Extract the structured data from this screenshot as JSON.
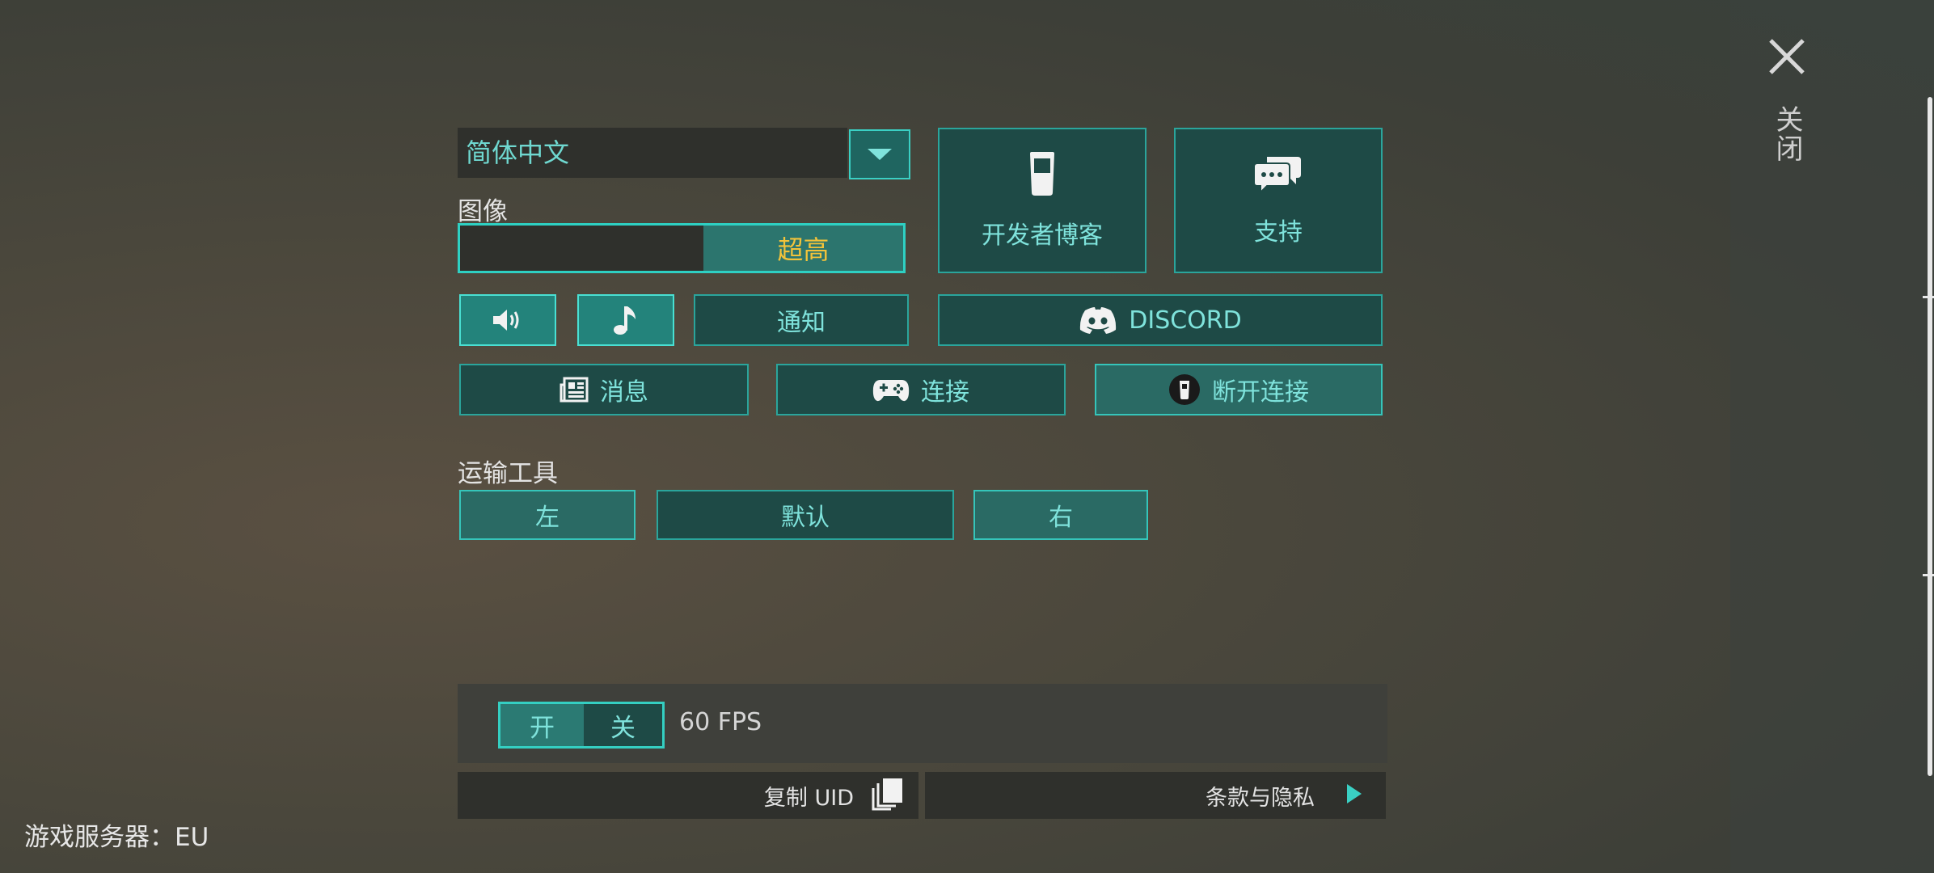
{
  "close": {
    "label": "关闭"
  },
  "language": {
    "selected": "简体中文"
  },
  "graphics": {
    "label": "图像",
    "quality": "超高",
    "level_fraction": 0.45
  },
  "links": {
    "dev_blog": "开发者博客",
    "support": "支持",
    "discord": "DISCORD"
  },
  "audio": {
    "notify": "通知"
  },
  "actions": {
    "news": "消息",
    "connect": "连接",
    "disconnect": "断开连接"
  },
  "vehicle": {
    "label": "运输工具",
    "left": "左",
    "default": "默认",
    "right": "右"
  },
  "fps": {
    "on": "开",
    "off": "关",
    "label": "60 FPS"
  },
  "footer": {
    "copy_uid": "复制 UID",
    "terms": "条款与隐私"
  },
  "server": {
    "label": "游戏服务器：EU"
  },
  "colors": {
    "accent": "#2aa59c",
    "accent_text": "#7fe3dc",
    "highlight": "#f2c33a",
    "button_bg": "#1e4a46"
  }
}
